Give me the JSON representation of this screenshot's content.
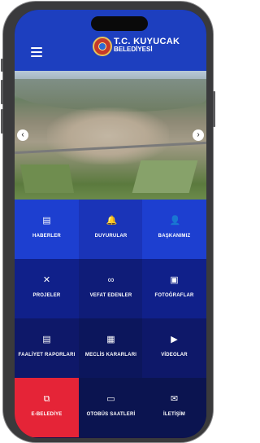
{
  "header": {
    "title_line1": "T.C. KUYUCAK",
    "title_line2": "BELEDİYESİ"
  },
  "hero": {
    "prev_label": "‹",
    "next_label": "›"
  },
  "tiles": [
    {
      "label": "HABERLER",
      "icon": "newspaper-icon",
      "glyph": "▤",
      "color": "#1d3fd0"
    },
    {
      "label": "DUYURULAR",
      "icon": "bell-icon",
      "glyph": "🔔",
      "color": "#1a34b8"
    },
    {
      "label": "BAŞKANIMIZ",
      "icon": "person-icon",
      "glyph": "👤",
      "color": "#1d3fd0"
    },
    {
      "label": "PROJELER",
      "icon": "tools-icon",
      "glyph": "✕",
      "color": "#10208a"
    },
    {
      "label": "VEFAT EDENLER",
      "icon": "infinity-icon",
      "glyph": "∞",
      "color": "#0f1c78"
    },
    {
      "label": "FOTOĞRAFLAR",
      "icon": "photos-icon",
      "glyph": "▣",
      "color": "#10208a"
    },
    {
      "label": "FAALİYET RAPORLARI",
      "icon": "report-icon",
      "glyph": "▤",
      "color": "#0e1869"
    },
    {
      "label": "MECLİS KARARLARI",
      "icon": "document-icon",
      "glyph": "▦",
      "color": "#0c165c"
    },
    {
      "label": "VİDEOLAR",
      "icon": "video-icon",
      "glyph": "▶",
      "color": "#0e1869"
    },
    {
      "label": "E-BELEDİYE",
      "icon": "external-link-icon",
      "glyph": "⧉",
      "color": "#e52437"
    },
    {
      "label": "OTOBÜS SAATLERİ",
      "icon": "bus-icon",
      "glyph": "▭",
      "color": "#0b1450"
    },
    {
      "label": "İLETİŞİM",
      "icon": "mail-icon",
      "glyph": "✉",
      "color": "#0b1450"
    }
  ]
}
